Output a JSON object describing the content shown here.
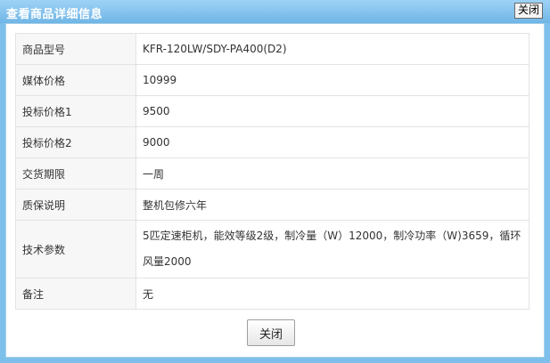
{
  "dialog": {
    "title": "查看商品详细信息",
    "close_x_label": "关闭"
  },
  "details": [
    {
      "label": "商品型号",
      "value": "KFR-120LW/SDY-PA400(D2)"
    },
    {
      "label": "媒体价格",
      "value": "10999"
    },
    {
      "label": "投标价格1",
      "value": "9500"
    },
    {
      "label": "投标价格2",
      "value": "9000"
    },
    {
      "label": "交货期限",
      "value": "一周"
    },
    {
      "label": "质保说明",
      "value": "整机包修六年"
    },
    {
      "label": "技术参数",
      "value": "5匹定速柜机，能效等级2级，制冷量（W）12000，制冷功率（W)3659，循环风量2000"
    },
    {
      "label": "备注",
      "value": "无"
    }
  ],
  "footer": {
    "close_button_label": "关闭"
  }
}
